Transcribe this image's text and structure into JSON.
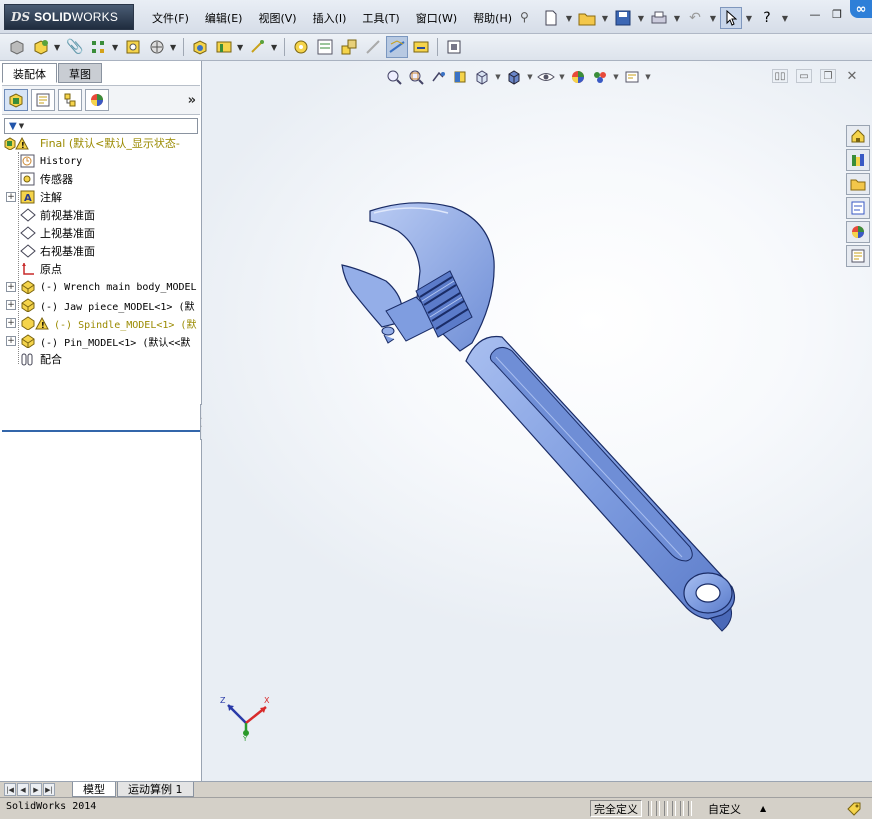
{
  "app": {
    "logo_ds": "DS",
    "logo_solid": "SOLID",
    "logo_works": "WORKS"
  },
  "menu": [
    "文件(F)",
    "编辑(E)",
    "视图(V)",
    "插入(I)",
    "工具(T)",
    "窗口(W)",
    "帮助(H)"
  ],
  "top_toolbar": {
    "help_label": "?"
  },
  "panel": {
    "tabs": [
      {
        "label": "装配体",
        "active": true
      },
      {
        "label": "草图",
        "active": false
      }
    ],
    "chevron": "»",
    "tree": [
      {
        "label": "Final  (默认<默认_显示状态-",
        "icon": "assembly-warning-icon",
        "indent": 0,
        "expander": "",
        "style": "yellow"
      },
      {
        "label": "History",
        "icon": "history-icon",
        "indent": 1,
        "expander": "",
        "style": "mono"
      },
      {
        "label": "传感器",
        "icon": "sensor-icon",
        "indent": 1,
        "expander": "",
        "style": ""
      },
      {
        "label": "注解",
        "icon": "annotation-icon",
        "indent": 1,
        "expander": "+",
        "style": ""
      },
      {
        "label": "前视基准面",
        "icon": "plane-icon",
        "indent": 1,
        "expander": "",
        "style": ""
      },
      {
        "label": "上视基准面",
        "icon": "plane-icon",
        "indent": 1,
        "expander": "",
        "style": ""
      },
      {
        "label": "右视基准面",
        "icon": "plane-icon",
        "indent": 1,
        "expander": "",
        "style": ""
      },
      {
        "label": "原点",
        "icon": "origin-icon",
        "indent": 1,
        "expander": "",
        "style": ""
      },
      {
        "label": "(-) Wrench main body_MODEL",
        "icon": "part-icon",
        "indent": 1,
        "expander": "+",
        "style": "mono"
      },
      {
        "label": "(-) Jaw piece_MODEL<1> (默",
        "icon": "part-icon",
        "indent": 1,
        "expander": "+",
        "style": "mono"
      },
      {
        "label": "(-) Spindle_MODEL<1> (默",
        "icon": "part-warning-icon",
        "indent": 1,
        "expander": "+",
        "style": "mono-yellow"
      },
      {
        "label": "(-) Pin_MODEL<1> (默认<<默",
        "icon": "part-icon",
        "indent": 1,
        "expander": "+",
        "style": "mono"
      },
      {
        "label": "配合",
        "icon": "mates-icon",
        "indent": 1,
        "expander": "",
        "style": ""
      }
    ]
  },
  "triad": {
    "x": "X",
    "y": "Y",
    "z": "Z"
  },
  "bottom_tabs": [
    {
      "label": "模型",
      "active": true
    },
    {
      "label": "运动算例 1",
      "active": false
    }
  ],
  "status": {
    "version": "SolidWorks 2014",
    "definition": "完全定义",
    "custom": "自定义",
    "custom_arrow": "▲"
  },
  "colors": {
    "wrench_fill": "#7f9de0",
    "wrench_dark": "#3b5aa6",
    "wrench_light": "#b4c7f2",
    "outline": "#1a2c66"
  }
}
